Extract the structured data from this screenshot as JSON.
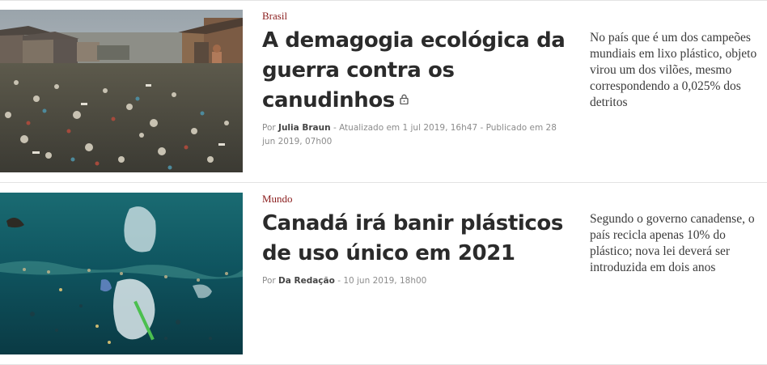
{
  "articles": [
    {
      "category": "Brasil",
      "title": "A demagogia ecológica da guerra contra os canudinhos",
      "locked": true,
      "byline": {
        "prefix": "Por",
        "author": "Julia Braun",
        "updated": "- Atualizado em 1 jul 2019, 16h47",
        "published": "- Publicado em 28 jun 2019, 07h00"
      },
      "summary": "No país que é um dos campeões mundiais em lixo plástico, objeto virou um dos vilões, mesmo correspondendo a 0,025% dos detritos",
      "image_icon": "polluted-river-photo"
    },
    {
      "category": "Mundo",
      "title": "Canadá irá banir plásticos de uso único em 2021",
      "locked": false,
      "byline": {
        "prefix": "Por",
        "author": "Da Redação",
        "date": "- 10 jun 2019, 18h00"
      },
      "summary": "Segundo o governo canadense, o país recicla apenas 10% do plástico; nova lei deverá ser introduzida em dois anos",
      "image_icon": "ocean-plastic-photo"
    }
  ],
  "colors": {
    "category": "#8a1c1c",
    "headline": "#2b2b2b",
    "meta": "#8c8c8c",
    "summary": "#3a3a3a",
    "divider": "#e3e3e3"
  }
}
